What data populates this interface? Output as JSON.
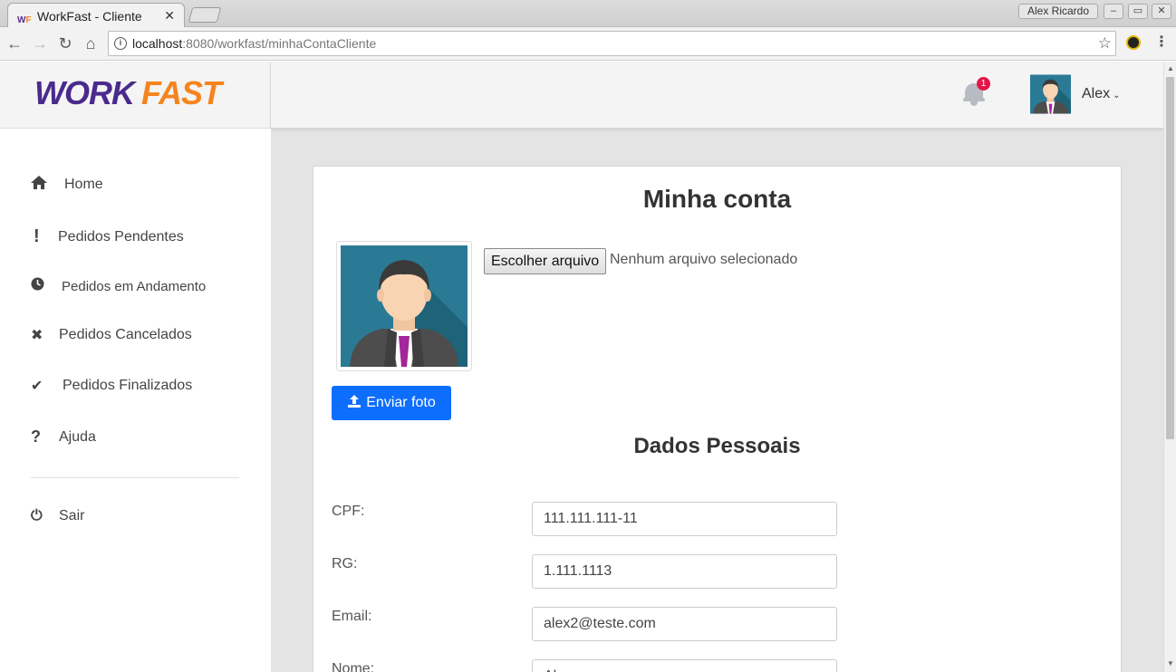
{
  "browser": {
    "tab_title": "WorkFast - Cliente",
    "tab_close": "✕",
    "window_user": "Alex Ricardo",
    "url_host": "localhost",
    "url_path": ":8080/workfast/minhaContaCliente"
  },
  "brand": {
    "logo_part1": "WORK",
    "logo_part2": "FAST"
  },
  "header": {
    "notification_count": "1",
    "user_name": "Alex"
  },
  "sidebar": {
    "items": [
      {
        "icon": "home-icon",
        "label": "Home"
      },
      {
        "icon": "exclamation-icon",
        "label": "Pedidos Pendentes"
      },
      {
        "icon": "clock-icon",
        "label": "Pedidos em Andamento"
      },
      {
        "icon": "times-icon",
        "label": "Pedidos Cancelados"
      },
      {
        "icon": "check-icon",
        "label": "Pedidos Finalizados"
      },
      {
        "icon": "question-icon",
        "label": "Ajuda"
      }
    ],
    "logout": {
      "icon": "power-icon",
      "label": "Sair"
    }
  },
  "account": {
    "title": "Minha conta",
    "file_button": "Escolher arquivo",
    "file_status": "Nenhum arquivo selecionado",
    "upload_button": "Enviar foto",
    "section_title": "Dados Pessoais",
    "fields": [
      {
        "label": "CPF:",
        "value": "111.111.111-11"
      },
      {
        "label": "RG:",
        "value": "1.111.1113"
      },
      {
        "label": "Email:",
        "value": "alex2@teste.com"
      },
      {
        "label": "Nome:",
        "value": "Alex"
      }
    ]
  },
  "colors": {
    "brand_purple": "#4a2a8c",
    "brand_orange": "#f5841f",
    "primary_button": "#0d6efd",
    "badge": "#e4154a"
  }
}
